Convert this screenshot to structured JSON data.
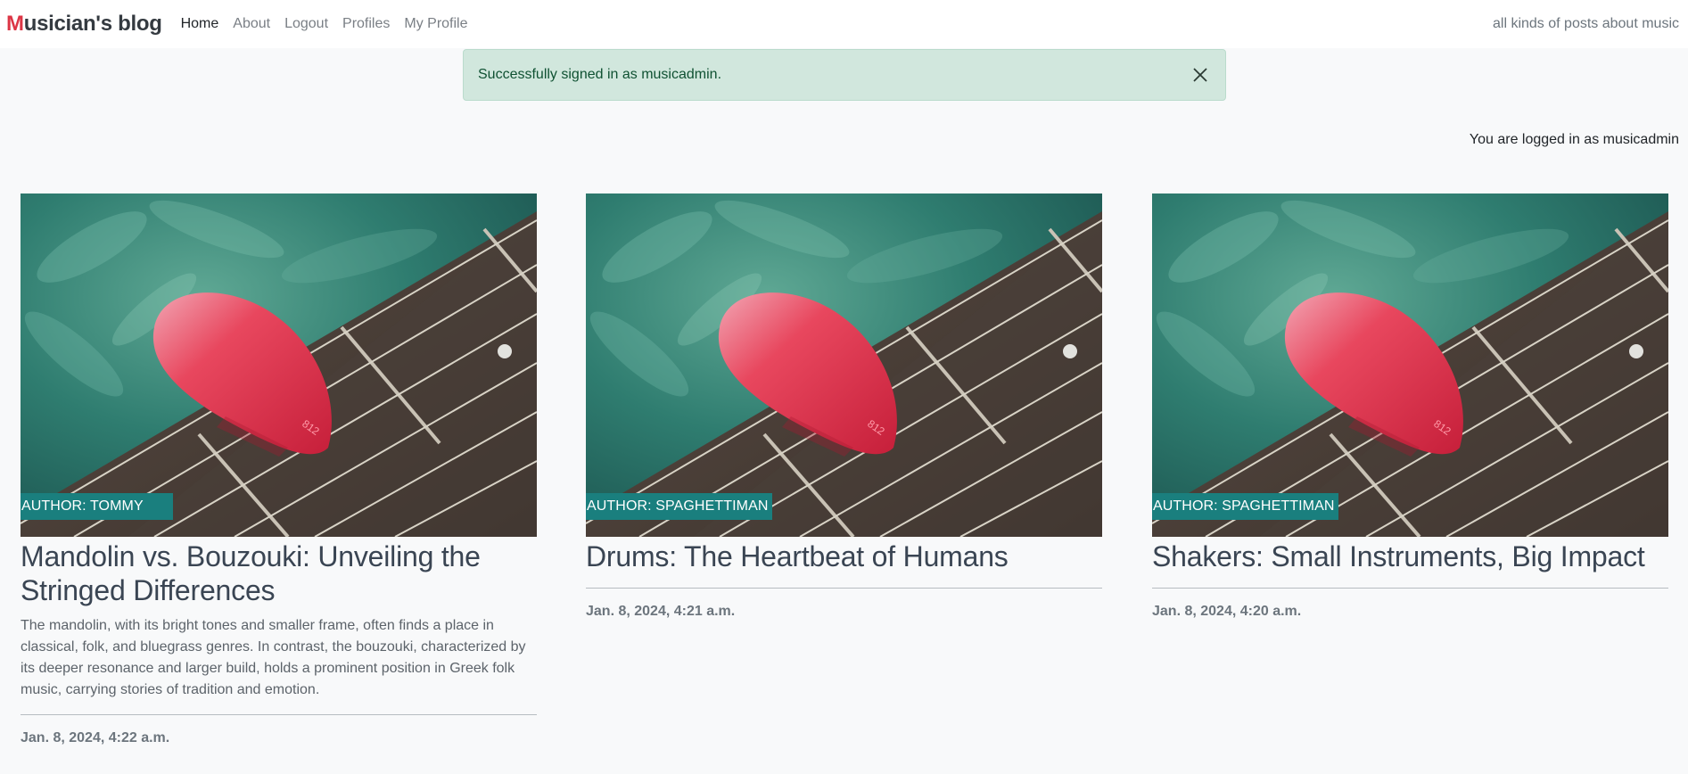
{
  "navbar": {
    "brand_first": "M",
    "brand_rest": "usician's blog",
    "links": {
      "home": "Home",
      "about": "About",
      "logout": "Logout",
      "profiles": "Profiles",
      "my_profile": "My Profile"
    },
    "tagline": "all kinds of posts about music"
  },
  "alert": {
    "message": "Successfully signed in as musicadmin.",
    "close_icon": "close-icon"
  },
  "status": {
    "logged_in_text": "You are logged in as musicadmin"
  },
  "posts": [
    {
      "author": "AUTHOR: TOMMY",
      "title": "Mandolin vs. Bouzouki: Unveiling the Stringed Differences",
      "excerpt": "The mandolin, with its bright tones and smaller frame, often finds a place in classical, folk, and bluegrass genres. In contrast, the bouzouki, characterized by its deeper resonance and larger build, holds a prominent position in Greek folk music, carrying stories of tradition and emotion.",
      "date": "Jan. 8, 2024, 4:22 a.m.",
      "image_icon": "guitar-pick-photo"
    },
    {
      "author": "AUTHOR: SPAGHETTIMAN",
      "title": "Drums: The Heartbeat of Humans",
      "excerpt": "",
      "date": "Jan. 8, 2024, 4:21 a.m.",
      "image_icon": "guitar-pick-photo"
    },
    {
      "author": "AUTHOR: SPAGHETTIMAN",
      "title": "Shakers: Small Instruments, Big Impact",
      "excerpt": "",
      "date": "Jan. 8, 2024, 4:20 a.m.",
      "image_icon": "guitar-pick-photo"
    }
  ],
  "colors": {
    "brand_accent": "#dc3545",
    "alert_bg": "#d1e7dd",
    "alert_text": "#0f5132",
    "author_badge": "#1a7f7e",
    "page_bg": "#f8f9fa"
  }
}
